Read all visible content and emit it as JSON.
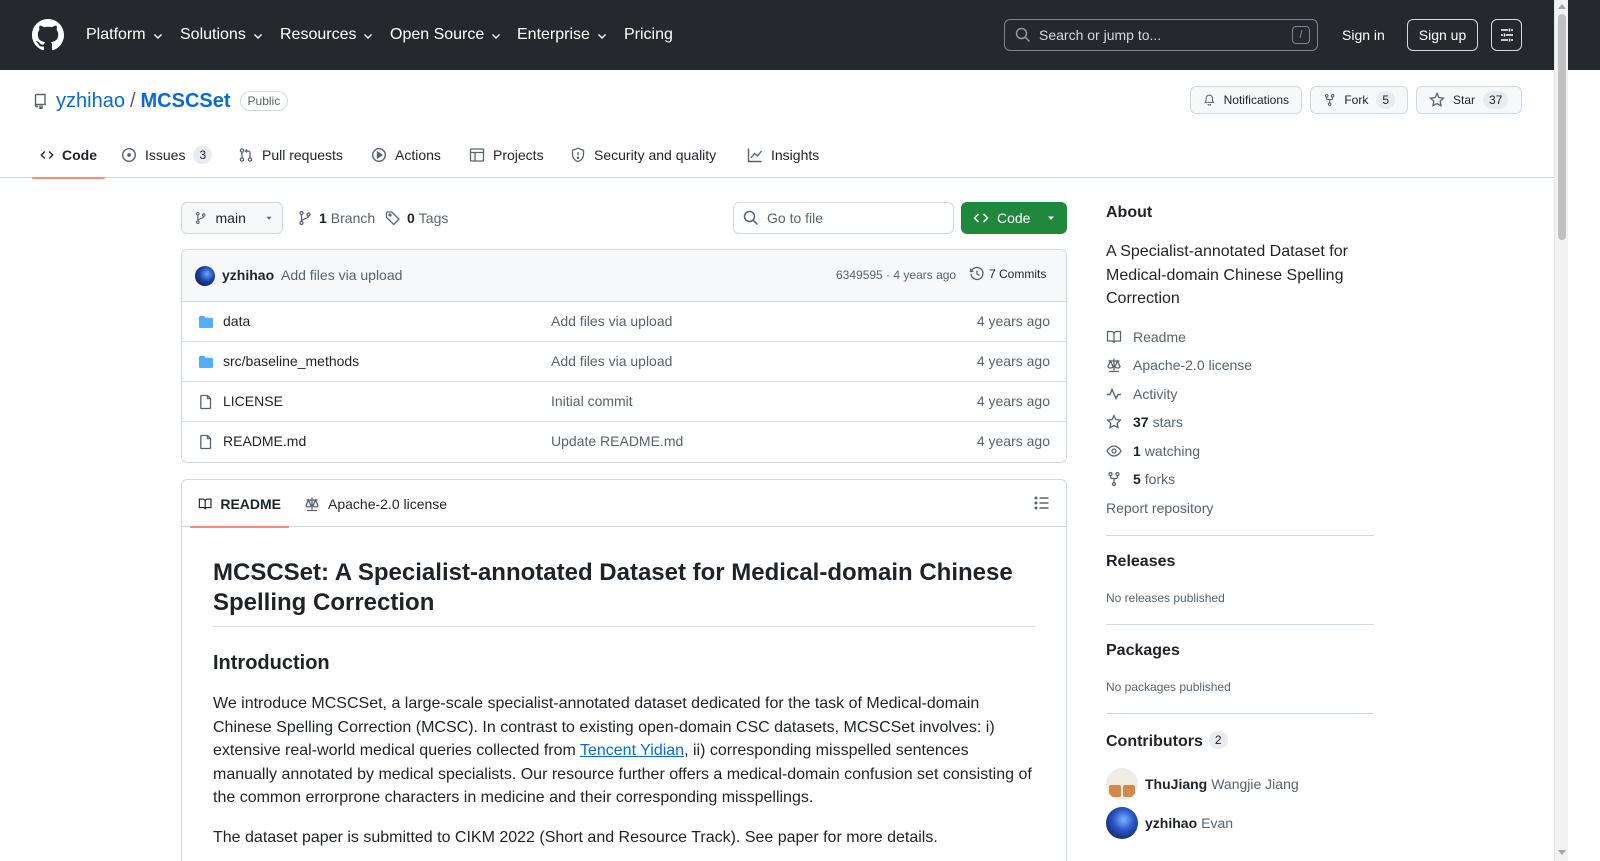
{
  "header": {
    "nav": [
      {
        "label": "Platform",
        "dropdown": true
      },
      {
        "label": "Solutions",
        "dropdown": true
      },
      {
        "label": "Resources",
        "dropdown": true
      },
      {
        "label": "Open Source",
        "dropdown": true
      },
      {
        "label": "Enterprise",
        "dropdown": true
      },
      {
        "label": "Pricing",
        "dropdown": false
      }
    ],
    "search_placeholder": "Search or jump to...",
    "search_shortcut": "/",
    "sign_in": "Sign in",
    "sign_up": "Sign up"
  },
  "repo": {
    "owner": "yzhihao",
    "separator": "/",
    "name": "MCSCSet",
    "visibility": "Public",
    "notifications_label": "Notifications",
    "fork_label": "Fork",
    "fork_count": "5",
    "star_label": "Star",
    "star_count": "37"
  },
  "tabs": [
    {
      "label": "Code",
      "icon": "code-icon",
      "selected": true
    },
    {
      "label": "Issues",
      "icon": "issue-icon",
      "count": "3"
    },
    {
      "label": "Pull requests",
      "icon": "pull-request-icon"
    },
    {
      "label": "Actions",
      "icon": "play-icon"
    },
    {
      "label": "Projects",
      "icon": "table-icon"
    },
    {
      "label": "Security and quality",
      "icon": "shield-icon"
    },
    {
      "label": "Insights",
      "icon": "graph-icon"
    }
  ],
  "filenav": {
    "branch": "main",
    "branch_count": "1",
    "branch_label": "Branch",
    "tag_count": "0",
    "tag_label": "Tags",
    "goto_placeholder": "Go to file",
    "code_button": "Code"
  },
  "latest_commit": {
    "author": "yzhihao",
    "message": "Add files via upload",
    "hash_age": "6349595 · 4 years ago",
    "commits": "7 Commits"
  },
  "files": [
    {
      "name": "data",
      "type": "folder",
      "message": "Add files via upload",
      "age": "4 years ago"
    },
    {
      "name": "src/baseline_methods",
      "type": "folder",
      "message": "Add files via upload",
      "age": "4 years ago"
    },
    {
      "name": "LICENSE",
      "type": "file",
      "message": "Initial commit",
      "age": "4 years ago"
    },
    {
      "name": "README.md",
      "type": "file",
      "message": "Update README.md",
      "age": "4 years ago"
    }
  ],
  "readme": {
    "tab_readme": "README",
    "tab_license": "Apache-2.0 license",
    "title": "MCSCSet: A Specialist-annotated Dataset for Medical-domain Chinese Spelling Correction",
    "section_intro": "Introduction",
    "intro_p1_before": "We introduce MCSCSet, a large-scale specialist-annotated dataset dedicated for the task of Medical-domain Chinese Spelling Correction (MCSC). In contrast to existing open-domain CSC datasets, MCSCSet involves: i) extensive real-world medical queries collected from ",
    "intro_p1_link": "Tencent Yidian",
    "intro_p1_after": ", ii) corresponding misspelled sentences manually annotated by medical specialists. Our resource further offers a medical-domain confusion set consisting of the common errorprone characters in medicine and their corresponding misspellings.",
    "intro_p2": "The dataset paper is submitted to CIKM 2022 (Short and Resource Track). See paper for more details."
  },
  "sidebar": {
    "about_heading": "About",
    "description": "A Specialist-annotated Dataset for Medical-domain Chinese Spelling Correction",
    "readme": "Readme",
    "license": "Apache-2.0 license",
    "activity": "Activity",
    "stars_count": "37",
    "stars_label": "stars",
    "watching_count": "1",
    "watching_label": "watching",
    "forks_count": "5",
    "forks_label": "forks",
    "report": "Report repository",
    "releases_heading": "Releases",
    "releases_empty": "No releases published",
    "packages_heading": "Packages",
    "packages_empty": "No packages published",
    "contributors_heading": "Contributors",
    "contributors_count": "2",
    "contributors": [
      {
        "login": "ThuJiang",
        "name": "Wangjie Jiang"
      },
      {
        "login": "yzhihao",
        "name": "Evan"
      }
    ]
  }
}
